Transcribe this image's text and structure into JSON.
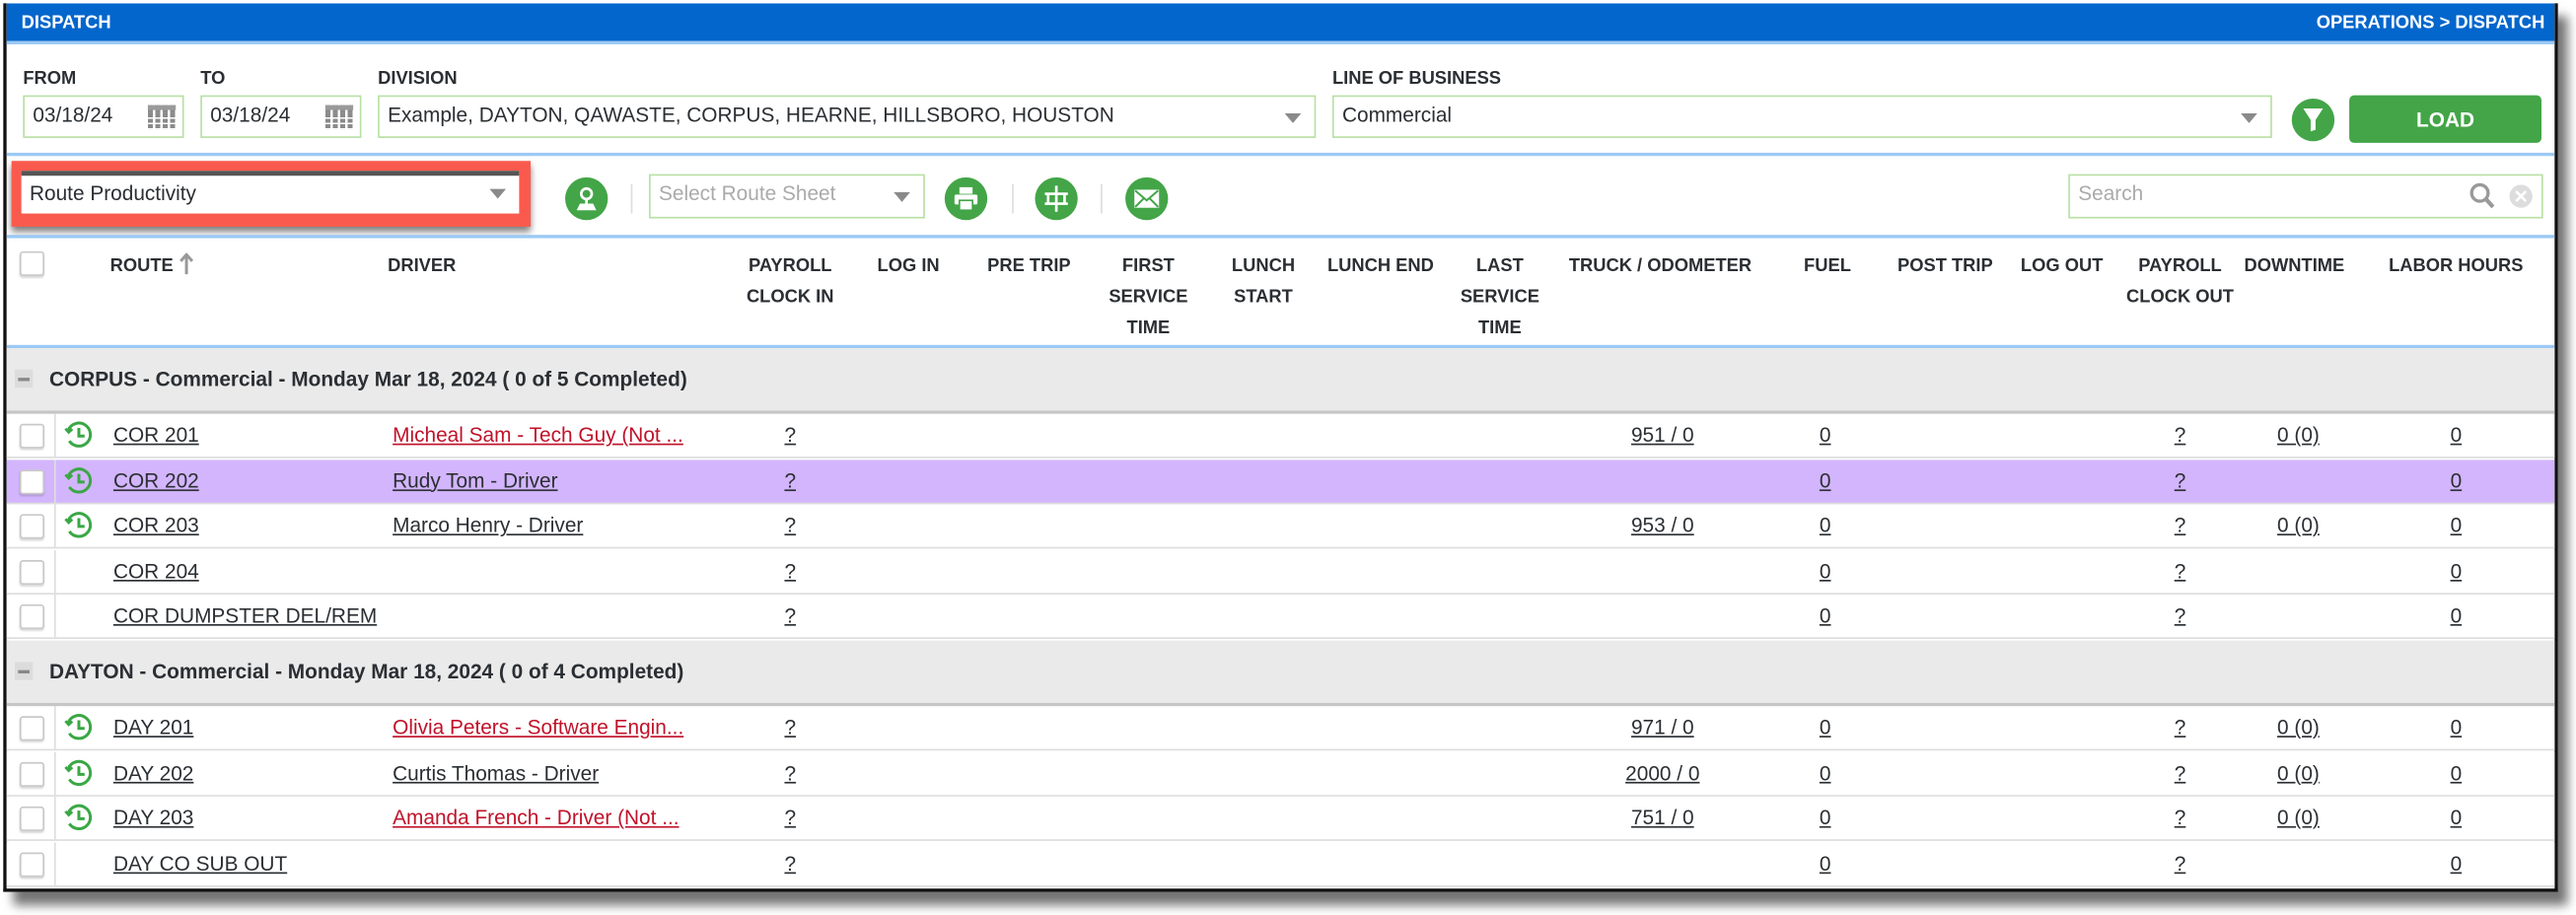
{
  "header": {
    "title": "DISPATCH",
    "breadcrumb": "OPERATIONS > DISPATCH"
  },
  "filters": {
    "from_label": "FROM",
    "from_value": "03/18/24",
    "to_label": "TO",
    "to_value": "03/18/24",
    "division_label": "DIVISION",
    "division_value": "Example, DAYTON, QAWASTE, CORPUS, HEARNE, HILLSBORO, HOUSTON",
    "lob_label": "LINE OF BUSINESS",
    "lob_value": "Commercial",
    "load_label": "LOAD"
  },
  "toolbar": {
    "report_value": "Route Productivity",
    "route_sheet_placeholder": "Select Route Sheet",
    "search_placeholder": "Search",
    "highlight_color": "#fa5a4e"
  },
  "columns": {
    "route": "ROUTE",
    "driver": "DRIVER",
    "payroll_in_1": "PAYROLL",
    "payroll_in_2": "CLOCK IN",
    "login": "LOG IN",
    "pretrip": "PRE TRIP",
    "first_1": "FIRST",
    "first_2": "SERVICE",
    "first_3": "TIME",
    "lunch_start_1": "LUNCH",
    "lunch_start_2": "START",
    "lunch_end": "LUNCH END",
    "last_1": "LAST",
    "last_2": "SERVICE",
    "last_3": "TIME",
    "truck": "TRUCK / ODOMETER",
    "fuel": "FUEL",
    "posttrip": "POST TRIP",
    "logout": "LOG OUT",
    "payroll_out_1": "PAYROLL",
    "payroll_out_2": "CLOCK OUT",
    "downtime": "DOWNTIME",
    "labor": "LABOR HOURS"
  },
  "colors": {
    "brand": "#0366cc",
    "accent_green": "#43a547",
    "selected_row": "#d3b5fd",
    "warning_driver": "#c0122a"
  },
  "groups": [
    {
      "title": "CORPUS - Commercial - Monday Mar 18, 2024 ( 0 of 5 Completed)",
      "rows": [
        {
          "route": "COR 201",
          "driver": "Micheal Sam - Tech Guy (Not ...",
          "driver_warning": true,
          "clock": true,
          "payroll_in": "?",
          "truck": "951 / 0",
          "fuel": "0",
          "payroll_out": "?",
          "downtime": "0 (0)",
          "labor": "0",
          "selected": false
        },
        {
          "route": "COR 202",
          "driver": "Rudy Tom - Driver",
          "driver_warning": false,
          "clock": true,
          "payroll_in": "?",
          "truck": "",
          "fuel": "0",
          "payroll_out": "?",
          "downtime": "",
          "labor": "0",
          "selected": true
        },
        {
          "route": "COR 203",
          "driver": "Marco Henry - Driver",
          "driver_warning": false,
          "clock": true,
          "payroll_in": "?",
          "truck": "953 / 0",
          "fuel": "0",
          "payroll_out": "?",
          "downtime": "0 (0)",
          "labor": "0",
          "selected": false
        },
        {
          "route": "COR 204",
          "driver": "",
          "driver_warning": false,
          "clock": false,
          "payroll_in": "?",
          "truck": "",
          "fuel": "0",
          "payroll_out": "?",
          "downtime": "",
          "labor": "0",
          "selected": false
        },
        {
          "route": "COR DUMPSTER DEL/REM",
          "driver": "",
          "driver_warning": false,
          "clock": false,
          "payroll_in": "?",
          "truck": "",
          "fuel": "0",
          "payroll_out": "?",
          "downtime": "",
          "labor": "0",
          "selected": false
        }
      ]
    },
    {
      "title": "DAYTON - Commercial - Monday Mar 18, 2024 ( 0 of 4 Completed)",
      "rows": [
        {
          "route": "DAY 201",
          "driver": "Olivia Peters - Software Engin...",
          "driver_warning": true,
          "clock": true,
          "payroll_in": "?",
          "truck": "971 / 0",
          "fuel": "0",
          "payroll_out": "?",
          "downtime": "0 (0)",
          "labor": "0",
          "selected": false
        },
        {
          "route": "DAY 202",
          "driver": "Curtis Thomas - Driver",
          "driver_warning": false,
          "clock": true,
          "payroll_in": "?",
          "truck": "2000 / 0",
          "fuel": "0",
          "payroll_out": "?",
          "downtime": "0 (0)",
          "labor": "0",
          "selected": false
        },
        {
          "route": "DAY 203",
          "driver": "Amanda French - Driver (Not ...",
          "driver_warning": true,
          "clock": true,
          "payroll_in": "?",
          "truck": "751 / 0",
          "fuel": "0",
          "payroll_out": "?",
          "downtime": "0 (0)",
          "labor": "0",
          "selected": false
        },
        {
          "route": "DAY CO SUB OUT",
          "driver": "",
          "driver_warning": false,
          "clock": false,
          "payroll_in": "?",
          "truck": "",
          "fuel": "0",
          "payroll_out": "?",
          "downtime": "",
          "labor": "0",
          "selected": false
        }
      ]
    }
  ]
}
